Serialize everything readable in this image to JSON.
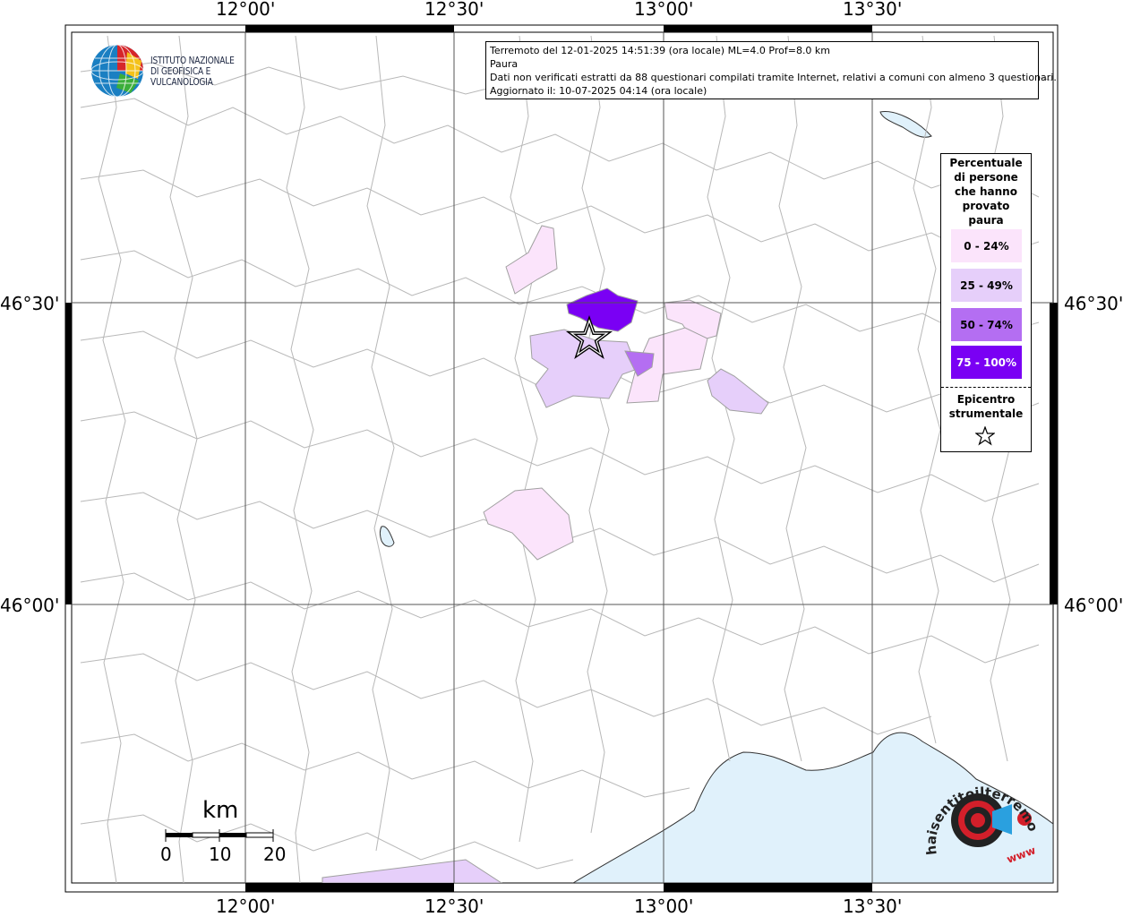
{
  "map": {
    "graticule": {
      "top_labels": [
        "12°00'",
        "12°30'",
        "13°00'",
        "13°30'"
      ],
      "bottom_labels": [
        "12°00'",
        "12°30'",
        "13°00'",
        "13°30'"
      ],
      "left_labels": [
        "46°30'",
        "46°00'"
      ],
      "right_labels": [
        "46°30'",
        "46°00'"
      ]
    },
    "colors": {
      "land": "#ffffff",
      "sea": "#e0f1fb",
      "boundaries": "#b8b8b8",
      "grid": "#555555"
    },
    "epicenter_icon": "star-icon"
  },
  "info": {
    "line1": "Terremoto del 12-01-2025 14:51:39 (ora locale) ML=4.0 Prof=8.0 km",
    "line2": "Paura",
    "line3": "Dati non verificati estratti da 88 questionari compilati tramite Internet, relativi a comuni con almeno 3 questionari.",
    "line4": "Aggiornato il: 10-07-2025 04:14 (ora locale)"
  },
  "logo": {
    "line1": "ISTITUTO NAZIONALE",
    "line2": "DI GEOFISICA E VULCANOLOGIA"
  },
  "legend": {
    "title": [
      "Percentuale",
      "di persone",
      "che hanno",
      "provato",
      "paura"
    ],
    "classes": [
      {
        "label": "0 - 24%",
        "color": "#fbe4fb"
      },
      {
        "label": "25 - 49%",
        "color": "#e6cffa"
      },
      {
        "label": "50 - 74%",
        "color": "#b46ef2"
      },
      {
        "label": "75 - 100%",
        "color": "#7a00f4"
      }
    ],
    "epicenter_label": [
      "Epicentro",
      "strumentale"
    ]
  },
  "scalebar": {
    "unit": "km",
    "labels": [
      "0",
      "10",
      "20"
    ]
  },
  "hst_logo": {
    "text": "haisentitoilterremoto.it",
    "sub": "www"
  }
}
